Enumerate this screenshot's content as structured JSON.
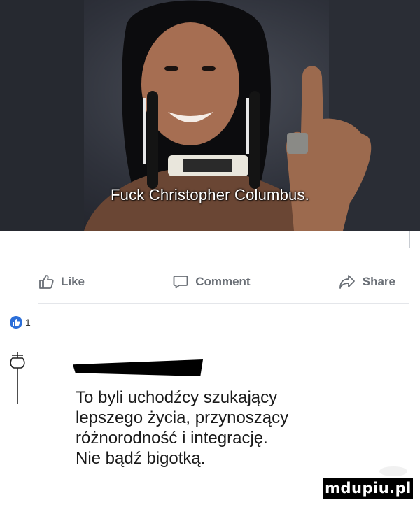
{
  "photo": {
    "caption": "Fuck Christopher Columbus."
  },
  "actions": {
    "like_label": "Like",
    "comment_label": "Comment",
    "share_label": "Share"
  },
  "reactions": {
    "count": "1"
  },
  "comment": {
    "text": "To byli uchodźcy szukający\nlepszego życia, przynoszący\nróżnorodność i integrację.\nNie bądź bigotką."
  },
  "watermark": {
    "text": "mdupiu.pl"
  },
  "icons": {
    "like": "thumbs-up-icon",
    "comment": "speech-bubble-icon",
    "share": "share-arrow-icon",
    "reaction": "like-badge-icon",
    "avatar": "rope-avatar-icon"
  }
}
